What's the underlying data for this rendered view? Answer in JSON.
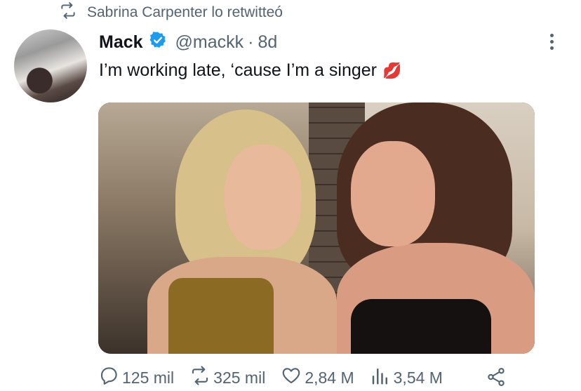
{
  "retweet": {
    "icon": "retweet-icon",
    "label": "Sabrina Carpenter lo retwitteó"
  },
  "tweet": {
    "author_name": "Mack",
    "verified_icon": "verified-badge-icon",
    "handle": "@mackk",
    "separator": "·",
    "time": "8d",
    "text": "I’m working late, ‘cause I’m a singer",
    "emoji": "💋"
  },
  "actions": {
    "replies": "125 mil",
    "retweets": "325 mil",
    "likes": "2,84 M",
    "views": "3,54 M"
  },
  "colors": {
    "muted": "#536471",
    "verified": "#1d9bf0",
    "text": "#0f1419"
  }
}
